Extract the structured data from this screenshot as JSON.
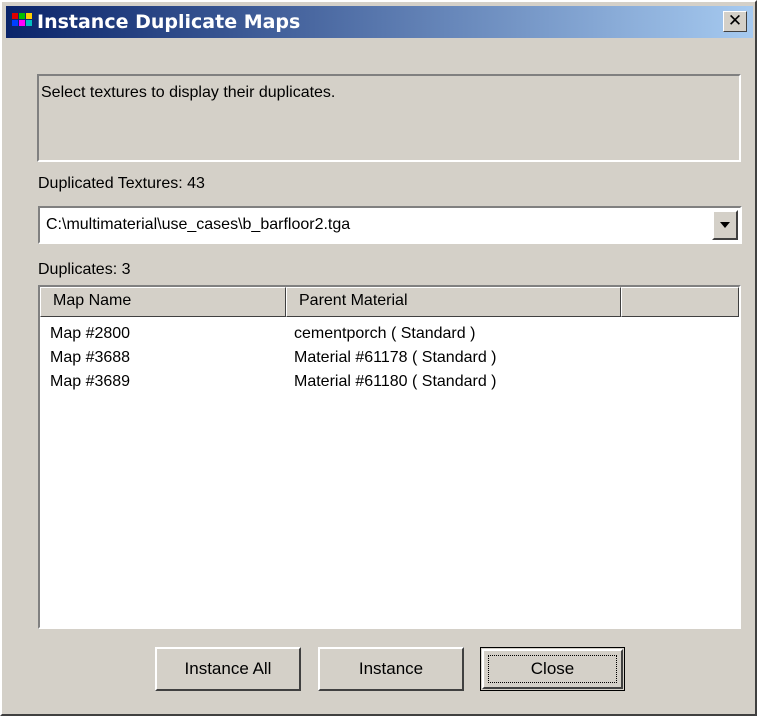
{
  "window": {
    "title": "Instance Duplicate Maps",
    "titlebar_gradient": [
      "#0a246a",
      "#a6caf0"
    ],
    "close_glyph": "✕"
  },
  "message": "Select textures to display their duplicates.",
  "duplicated_textures_label": "Duplicated Textures: 43",
  "texture_combo": {
    "selected": "C:\\multimaterial\\use_cases\\b_barfloor2.tga",
    "arrow_icon": "chevron-down-icon"
  },
  "duplicates_label": "Duplicates: 3",
  "list": {
    "columns": [
      "Map Name",
      "Parent Material",
      ""
    ],
    "rows": [
      {
        "map_name": "Map #2800",
        "parent_material": "cementporch  ( Standard )"
      },
      {
        "map_name": "Map #3688",
        "parent_material": "Material #61178  ( Standard )"
      },
      {
        "map_name": "Map #3689",
        "parent_material": "Material #61180  ( Standard )"
      }
    ]
  },
  "buttons": {
    "instance_all": "Instance All",
    "instance": "Instance",
    "close": "Close"
  }
}
